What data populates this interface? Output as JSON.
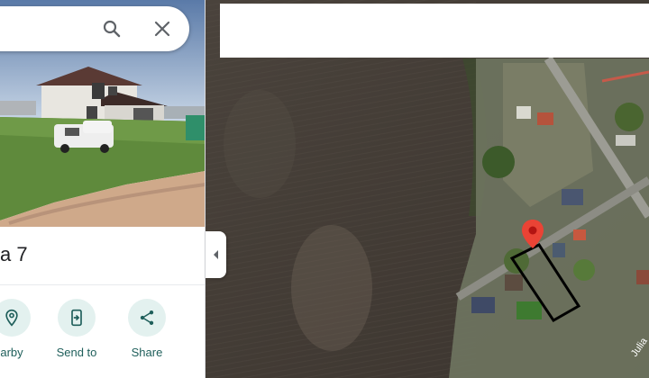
{
  "place": {
    "title_visible": "a 7"
  },
  "actions": [
    {
      "label": "arby",
      "icon": "nearby-icon"
    },
    {
      "label": "Send to",
      "icon": "send-to-phone-icon"
    },
    {
      "label": "Share",
      "icon": "share-icon"
    }
  ],
  "map": {
    "street_label": "Julia"
  },
  "colors": {
    "accent": "#1f5f5b",
    "chip_bg": "#e3f1ef",
    "pin": "#ea4335"
  }
}
